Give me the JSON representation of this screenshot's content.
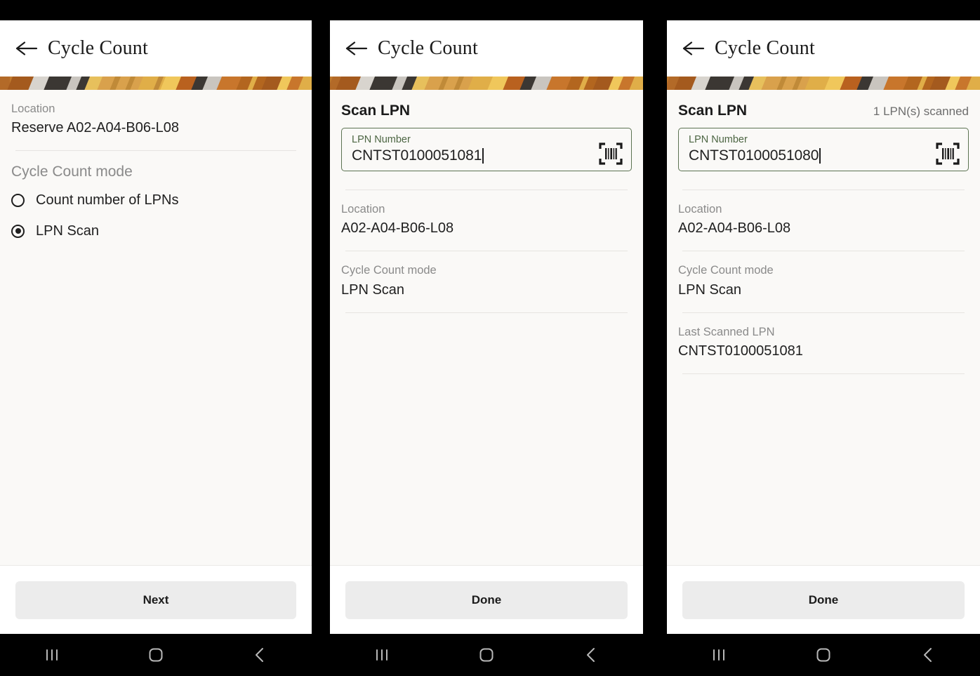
{
  "meta": {
    "platform": "android",
    "accent_green": "#4d6643",
    "field_border_green": "#5c7352",
    "label_gray": "#8a8a8a",
    "value_dark": "#1f1f1f",
    "button_gray": "#ececec",
    "content_bg": "#faf9f7",
    "navbar_bg": "#000000"
  },
  "icons": {
    "back_arrow": "arrow-left-icon",
    "barcode": "barcode-scan-icon",
    "nav_recents": "recents-icon",
    "nav_home": "home-icon",
    "nav_back": "back-chevron-icon"
  },
  "panels": [
    {
      "id": "panel-mode-select",
      "appbar": {
        "title": "Cycle Count",
        "back_label": "Back"
      },
      "fields": [
        {
          "label": "Location",
          "value": "Reserve A02-A04-B06-L08"
        }
      ],
      "radio_group": {
        "title": "Cycle Count mode",
        "options": [
          {
            "label": "Count number of LPNs",
            "selected": false
          },
          {
            "label": "LPN Scan",
            "selected": true
          }
        ]
      },
      "action": {
        "label": "Next"
      }
    },
    {
      "id": "panel-scan-first",
      "appbar": {
        "title": "Cycle Count",
        "back_label": "Back"
      },
      "scan": {
        "title": "Scan LPN",
        "count_text": "",
        "input": {
          "label": "LPN Number",
          "value": "CNTST0100051081",
          "placeholder": "LPN Number"
        }
      },
      "fields": [
        {
          "label": "Location",
          "value": "A02-A04-B06-L08"
        },
        {
          "label": "Cycle Count mode",
          "value": "LPN Scan"
        }
      ],
      "action": {
        "label": "Done"
      }
    },
    {
      "id": "panel-scan-second",
      "appbar": {
        "title": "Cycle Count",
        "back_label": "Back"
      },
      "scan": {
        "title": "Scan LPN",
        "count_text": "1 LPN(s) scanned",
        "input": {
          "label": "LPN Number",
          "value": "CNTST0100051080",
          "placeholder": "LPN Number"
        }
      },
      "fields": [
        {
          "label": "Location",
          "value": "A02-A04-B06-L08"
        },
        {
          "label": "Cycle Count mode",
          "value": "LPN Scan"
        },
        {
          "label": "Last Scanned LPN",
          "value": "CNTST0100051081"
        }
      ],
      "action": {
        "label": "Done"
      }
    }
  ],
  "banner_strip": {
    "description": "decorative-warehouse-photo-strip",
    "colors": [
      "#c8762c",
      "#e3a93a",
      "#f0c75b",
      "#3b3733",
      "#c9c5bf",
      "#a4561f",
      "#d9a14c"
    ]
  }
}
